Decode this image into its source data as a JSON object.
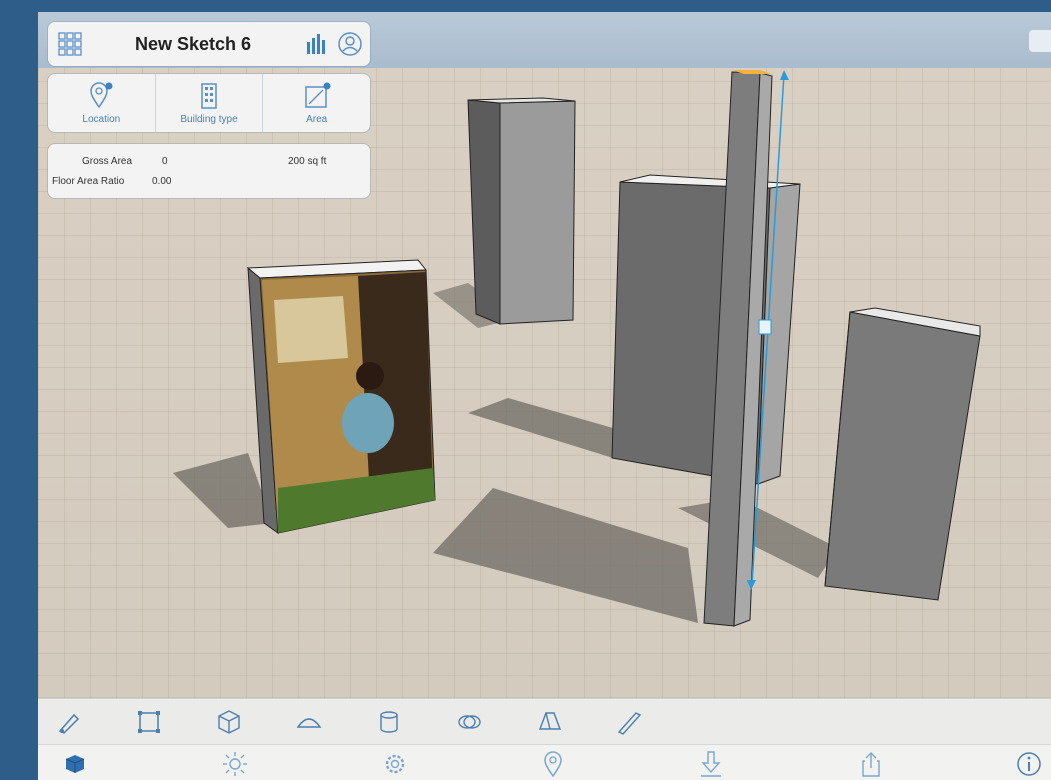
{
  "app": {
    "title": "New Sketch 6"
  },
  "tools": [
    {
      "label": "Location",
      "icon": "location-pin-icon"
    },
    {
      "label": "Building type",
      "icon": "building-icon"
    },
    {
      "label": "Area",
      "icon": "area-icon"
    }
  ],
  "info": {
    "gross_area_label": "Gross Area",
    "gross_area_value": "0",
    "gross_area_target": "200 sq ft",
    "far_label": "Floor Area Ratio",
    "far_value": "0.00"
  },
  "toolbar": {
    "items": [
      "pen-icon",
      "rectangle-icon",
      "box-icon",
      "dome-icon",
      "cylinder-icon",
      "lens-icon",
      "prism-icon",
      "knife-icon"
    ]
  },
  "tabbar": {
    "items": [
      "cube-icon",
      "sun-icon",
      "gear-icon",
      "location-pin-icon",
      "download-icon",
      "share-icon",
      "info-icon"
    ]
  },
  "colors": {
    "frame": "#2e5d8a",
    "accent": "#3b82c4",
    "ground": "#d6cfc3"
  }
}
